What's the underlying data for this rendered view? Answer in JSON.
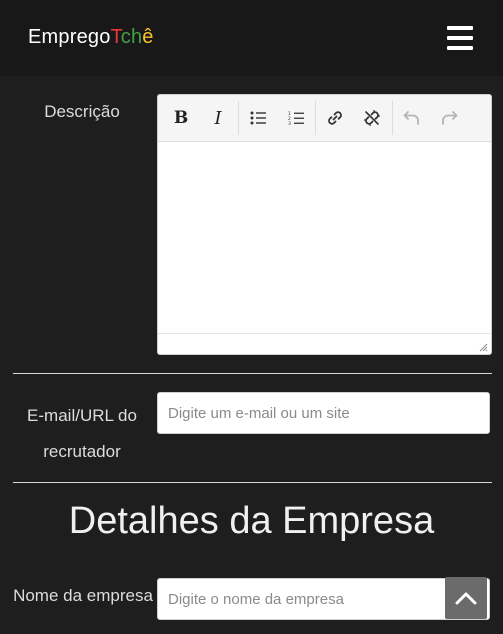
{
  "header": {
    "logo_part1": "Emprego",
    "logo_t": "T",
    "logo_ch": "ch",
    "logo_e": "ê",
    "menu_icon": "hamburger-menu-icon"
  },
  "form": {
    "description_label": "Descrição",
    "editor_toolbar": {
      "bold": "B",
      "italic": "I",
      "icons": [
        "bold-icon",
        "italic-icon",
        "bullet-list-icon",
        "numbered-list-icon",
        "link-icon",
        "unlink-icon",
        "undo-icon",
        "redo-icon"
      ]
    },
    "recruiter_label_line1": "E-mail/URL do",
    "recruiter_label_line2": "recrutador",
    "recruiter_placeholder": "Digite um e-mail ou um site",
    "company_section_title": "Detalhes da Empresa",
    "company_name_label": "Nome da empresa",
    "company_name_placeholder": "Digite o nome da empresa"
  },
  "colors": {
    "background": "#1e1e1e",
    "header": "#181818",
    "logo_red": "#e53935",
    "logo_green": "#43a047",
    "logo_yellow": "#fbc02d"
  }
}
